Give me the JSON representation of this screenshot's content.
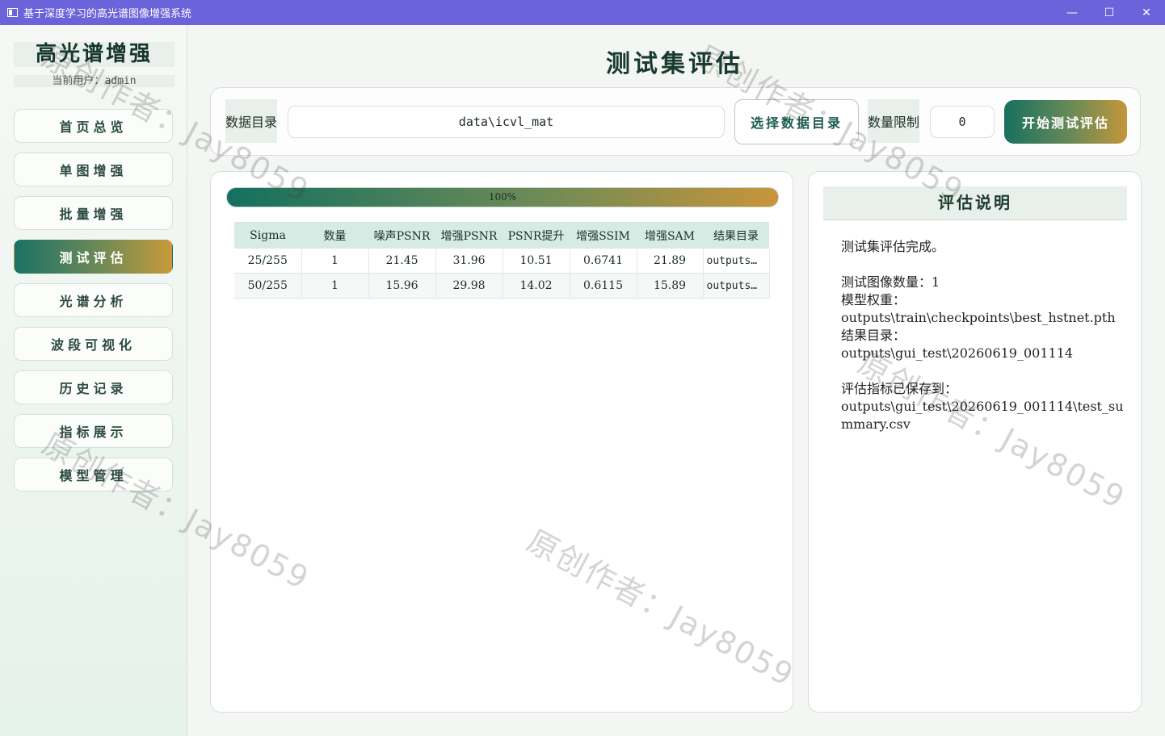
{
  "window": {
    "title": "基于深度学习的高光谱图像增强系统",
    "minimize": "—",
    "maximize": "☐",
    "close": "✕"
  },
  "sidebar": {
    "brand": "高光谱增强",
    "user_label": "当前用户：",
    "user_value": "admin",
    "items": [
      {
        "label": "首页总览",
        "active": false
      },
      {
        "label": "单图增强",
        "active": false
      },
      {
        "label": "批量增强",
        "active": false
      },
      {
        "label": "测试评估",
        "active": true
      },
      {
        "label": "光谱分析",
        "active": false
      },
      {
        "label": "波段可视化",
        "active": false
      },
      {
        "label": "历史记录",
        "active": false
      },
      {
        "label": "指标展示",
        "active": false
      },
      {
        "label": "模型管理",
        "active": false
      }
    ]
  },
  "page": {
    "title": "测试集评估"
  },
  "toolbar": {
    "data_dir_label": "数据目录",
    "data_dir_value": "data\\icvl_mat",
    "choose_dir_button": "选择数据目录",
    "limit_label": "数量限制",
    "limit_value": "0",
    "start_button": "开始测试评估"
  },
  "progress": {
    "percent": 100,
    "text": "100%"
  },
  "table": {
    "headers": [
      "Sigma",
      "数量",
      "噪声PSNR",
      "增强PSNR",
      "PSNR提升",
      "增强SSIM",
      "增强SAM",
      "结果目录"
    ],
    "rows": [
      [
        "25/255",
        "1",
        "21.45",
        "31.96",
        "10.51",
        "0.6741",
        "21.89",
        "outputs…"
      ],
      [
        "50/255",
        "1",
        "15.96",
        "29.98",
        "14.02",
        "0.6115",
        "15.89",
        "outputs…"
      ]
    ]
  },
  "info": {
    "title": "评估说明",
    "body": "测试集评估完成。\n\n测试图像数量：1\n模型权重：\noutputs\\train\\checkpoints\\best_hstnet.pth\n结果目录：\noutputs\\gui_test\\20260619_001114\n\n评估指标已保存到：\noutputs\\gui_test\\20260619_001114\\test_summary.csv"
  },
  "watermark": {
    "text": "原创作者：Jay8059"
  }
}
